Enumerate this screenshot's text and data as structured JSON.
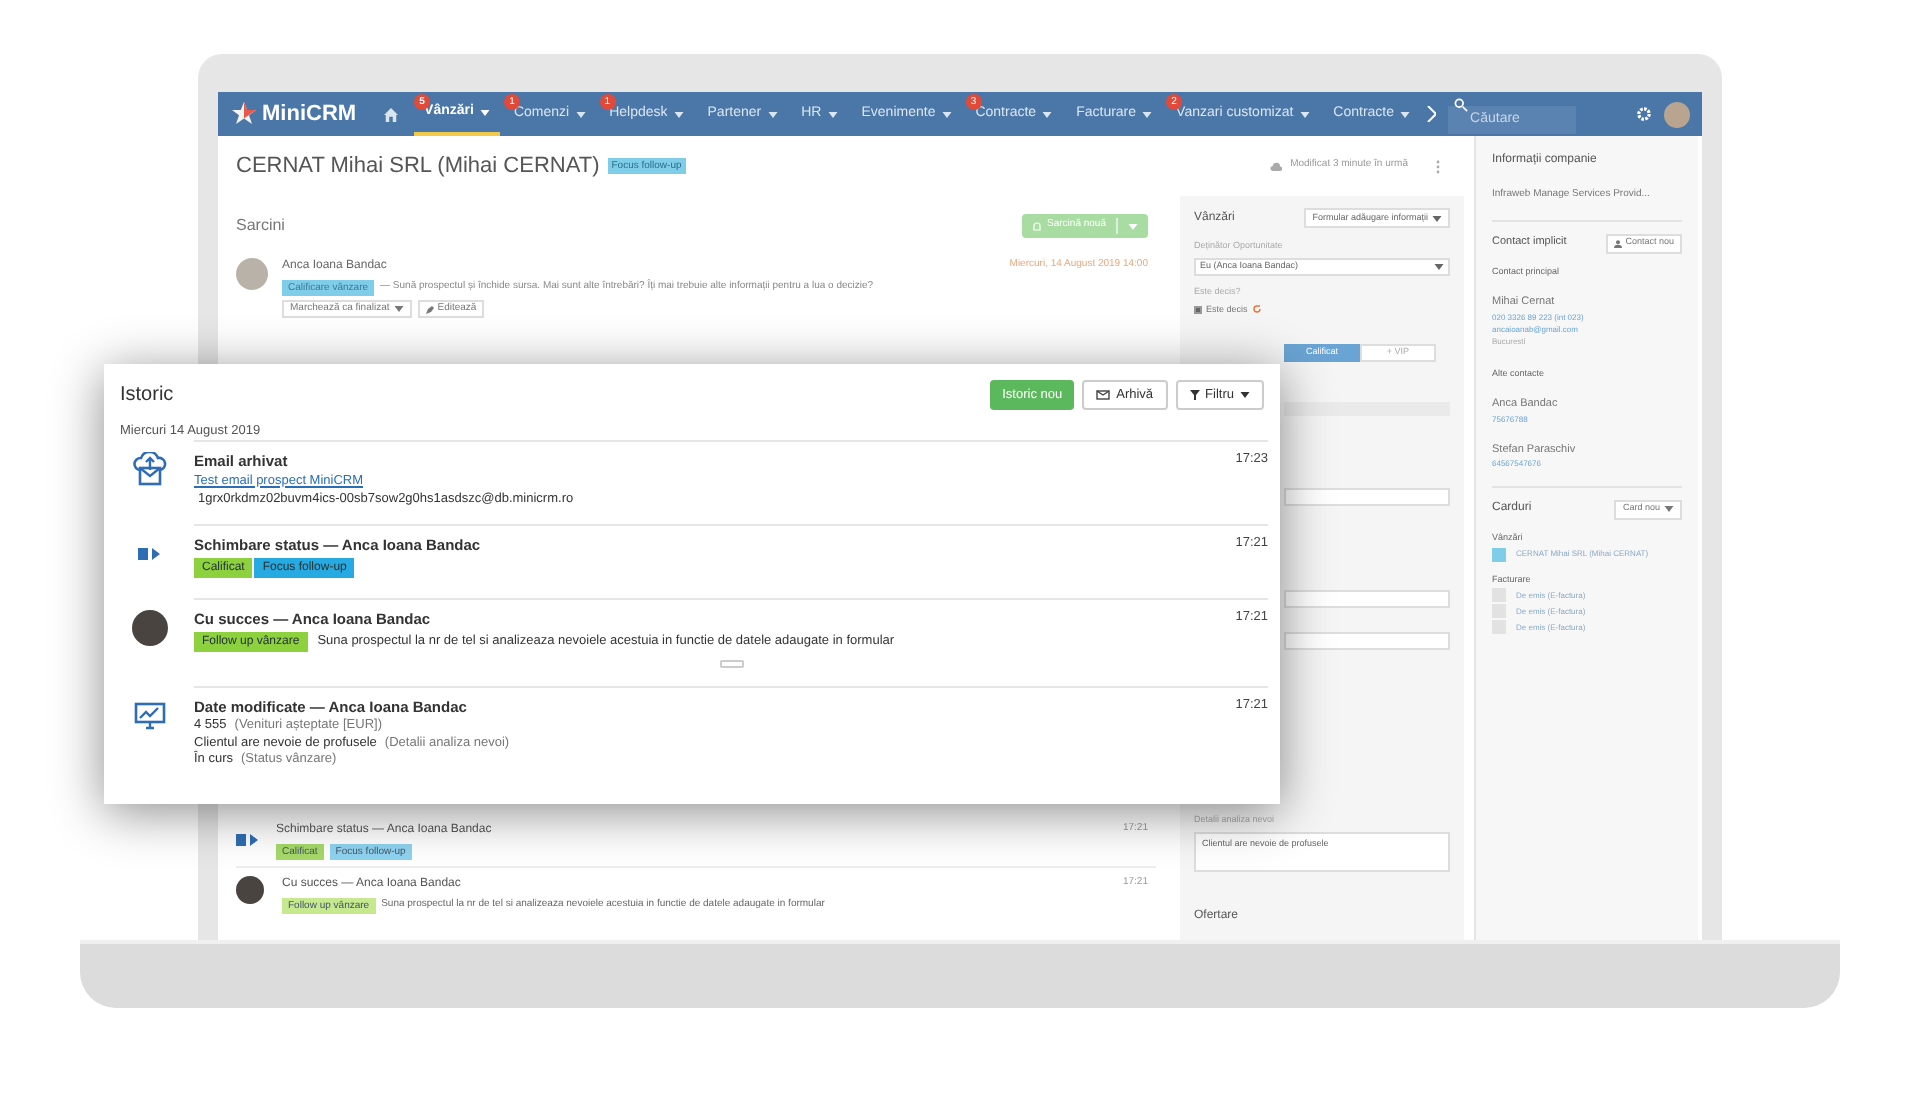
{
  "nav": {
    "logo": "MiniCRM",
    "items": [
      {
        "label": "Vânzări",
        "badge": "5",
        "selected": true
      },
      {
        "label": "Comenzi",
        "badge": "1",
        "selected": false
      },
      {
        "label": "Helpdesk",
        "badge": "1",
        "selected": false
      },
      {
        "label": "Partener",
        "selected": false
      },
      {
        "label": "HR",
        "selected": false
      },
      {
        "label": "Evenimente",
        "selected": false
      },
      {
        "label": "Contracte",
        "badge": "3",
        "selected": false
      },
      {
        "label": "Facturare",
        "selected": false
      },
      {
        "label": "Vanzari customizat",
        "badge": "2",
        "selected": false
      },
      {
        "label": "Contracte",
        "selected": false
      }
    ],
    "search": {
      "placeholder": "Căutare"
    }
  },
  "header": {
    "title": "CERNAT Mihai SRL (Mihai CERNAT)",
    "tag": "Focus follow-up",
    "modified": "Modificat 3 minute în urmă"
  },
  "tasks": {
    "title": "Sarcini",
    "new_button": "Sarcină nouă",
    "items": [
      {
        "name": "Anca Ioana Bandac",
        "tag": "Calificare vânzare",
        "text": "— Sună prospectul și închide sursa. Mai sunt alte întrebări? Îți mai trebuie alte informații pentru a lua o decizie?",
        "date": "Miercuri, 14 August 2019 14:00",
        "actions": [
          "Marchează ca finalizat",
          "Editează"
        ]
      }
    ]
  },
  "history_behind": [
    {
      "kind": "status",
      "title": "Schimbare status — Anca Ioana Bandac",
      "time": "17:21",
      "tags": [
        {
          "label": "Calificat",
          "color": "#a6d96a"
        },
        {
          "label": "Focus follow-up",
          "color": "#8fd3f0"
        }
      ]
    },
    {
      "kind": "success",
      "title": "Cu succes — Anca Ioana Bandac",
      "time": "17:21",
      "tags": [
        {
          "label": "Follow up vânzare",
          "color": "#c6e88f"
        }
      ],
      "text": "Suna prospectul la nr de tel  si analizeaza nevoiele acestuia in functie de datele adaugate in formular"
    }
  ],
  "form": {
    "section": "Vânzări",
    "form_button": "Formular adăugare informații",
    "owner_label": "Deținător Oportunitate",
    "owner_value": "Eu (Anca Ioana Bandac)",
    "decided_label": "Este decis?",
    "decided": {
      "label": "Este decis",
      "checked": true
    },
    "segments": [
      {
        "label": "Calificat",
        "selected": true
      },
      {
        "label": "+ VIP",
        "selected": false
      }
    ],
    "needs_label": "Detalii analiza nevoi",
    "needs_value": "Clientul are nevoie de profusele",
    "offer_label": "Ofertare"
  },
  "sidebar": {
    "company_title": "Informații companie",
    "company_name": "Infraweb Manage Services Provid...",
    "contact_title": "Contact implicit",
    "contact_button": "Contact nou",
    "primary_label": "Contact principal",
    "primary": {
      "name": "Mihai Cernat",
      "phone": "020 3326 89 223 (int 023)",
      "email": "ancaioanab@gmail.com",
      "city": "Bucuresti"
    },
    "others_label": "Alte contacte",
    "others": [
      {
        "name": "Anca Bandac",
        "phone": "75676788"
      },
      {
        "name": "Stefan Paraschiv",
        "phone": "64567547676"
      }
    ],
    "cards_title": "Carduri",
    "card_button": "Card nou",
    "groups": [
      {
        "title": "Vânzări",
        "items": [
          {
            "label": "CERNAT Mihai SRL (Mihai CERNAT)",
            "color": "#7fcde9"
          }
        ]
      },
      {
        "title": "Facturare",
        "items": [
          {
            "label": "De emis (E-factura)",
            "color": "#e2e2e2"
          },
          {
            "label": "De emis (E-factura)",
            "color": "#e2e2e2"
          },
          {
            "label": "De emis (E-factura)",
            "color": "#e2e2e2"
          }
        ]
      }
    ]
  },
  "history_popup": {
    "title": "Istoric",
    "buttons": [
      {
        "label": "Istoric nou",
        "kind": "primary"
      },
      {
        "label": "Arhivă",
        "kind": "archive"
      },
      {
        "label": "Filtru",
        "kind": "filter"
      }
    ],
    "date": "Miercuri 14 August 2019",
    "entries": [
      {
        "kind": "email",
        "title": "Email arhivat",
        "time": "17:23",
        "link": "Test email prospect MiniCRM",
        "text": "1grx0rkdmz02buvm4ics-00sb7sow2g0hs1asdszc@db.minicrm.ro"
      },
      {
        "kind": "status",
        "title": "Schimbare status — Anca Ioana Bandac",
        "time": "17:21",
        "tags": [
          {
            "label": "Calificat",
            "color": "#8ed13f"
          },
          {
            "label": "Focus follow-up",
            "color": "#27a9e1"
          }
        ]
      },
      {
        "kind": "success",
        "title": "Cu succes — Anca Ioana Bandac",
        "time": "17:21",
        "tags": [
          {
            "label": "Follow up vânzare",
            "color": "#8ed13f"
          }
        ],
        "text": "Suna prospectul la nr de tel  si analizeaza nevoiele acestuia in functie de datele adaugate in formular"
      },
      {
        "kind": "data",
        "title": "Date modificate — Anca Ioana Bandac",
        "time": "17:21",
        "fields": [
          {
            "value": "4 555",
            "field": "(Venituri așteptate [EUR])"
          },
          {
            "value": "Clientul are nevoie de profusele",
            "field": "(Detalii analiza nevoi)"
          },
          {
            "value": "În curs",
            "field": "(Status vânzare)"
          }
        ]
      }
    ]
  }
}
